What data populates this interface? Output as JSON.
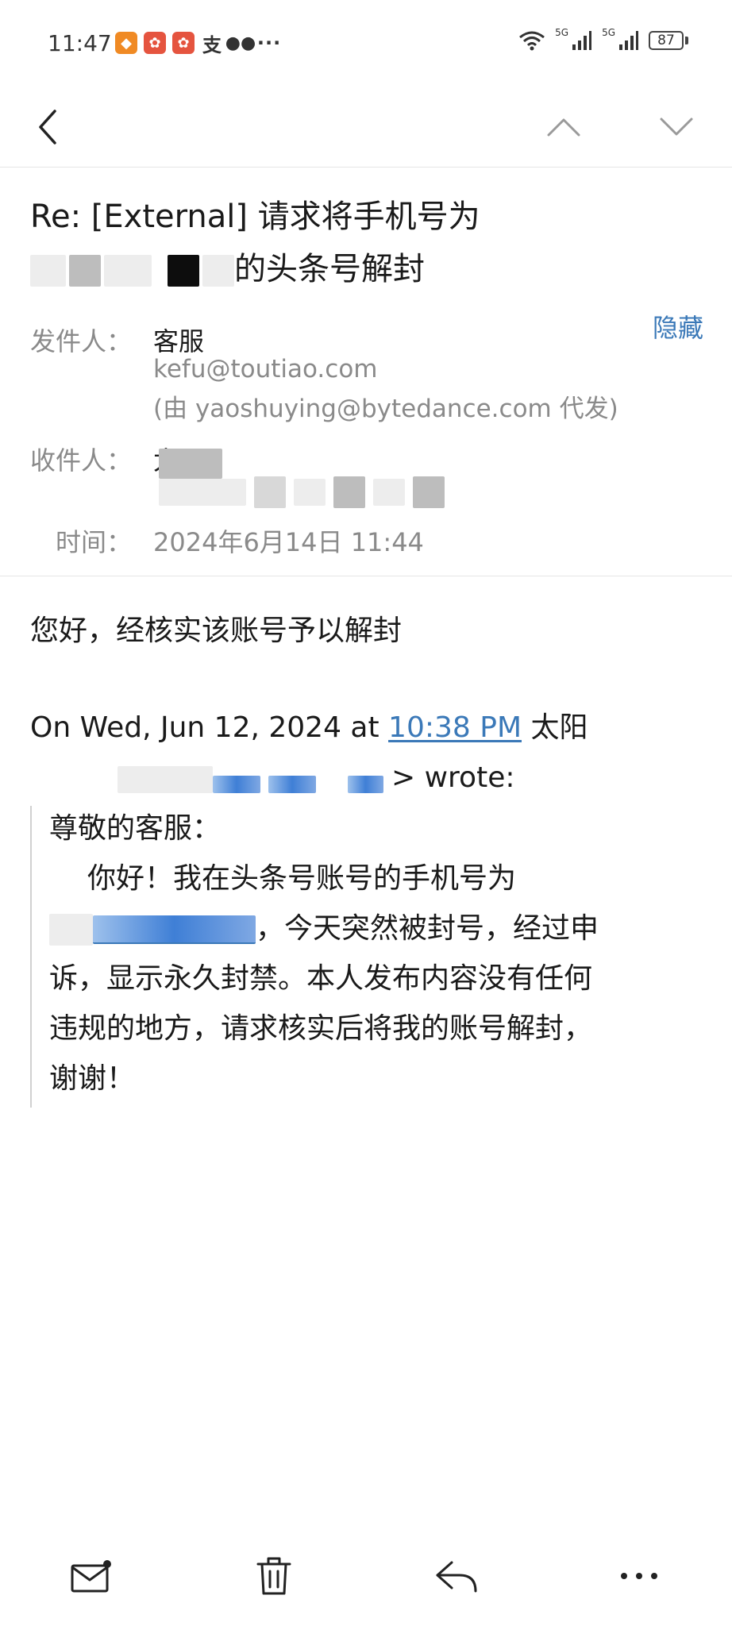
{
  "status_bar": {
    "time": "11:47",
    "network_1": "5G",
    "network_2": "5G",
    "battery": "87",
    "more": "···"
  },
  "email": {
    "subject_line1": "Re: [External] 请求将手机号为",
    "subject_line2_suffix": "的头条号解封",
    "sender_label": "发件人：",
    "sender_name": "客服",
    "sender_email": "kefu@toutiao.com",
    "sender_via": "(由 yaoshuying@bytedance.com 代发)",
    "hide_label": "隐藏",
    "recipient_label": "收件人：",
    "recipient_name": "太阳",
    "time_label": "时间：",
    "time_value": "2024年6月14日 11:44"
  },
  "body": {
    "reply": "您好，经核实该账号予以解封",
    "quote_intro_prefix": "On Wed, Jun 12, 2024 at ",
    "quote_intro_time": "10:38 PM",
    "quote_intro_name": " 太阳",
    "quote_intro_wrote": "> wrote:",
    "quote_greeting": "尊敬的客服：",
    "quote_line1": "你好！我在头条号账号的手机号为",
    "quote_line2_suffix": "，今天突然被封号，经过申",
    "quote_line3": "诉，显示永久封禁。本人发布内容没有任何",
    "quote_line4": "违规的地方，请求核实后将我的账号解封，",
    "quote_line5": "谢谢！"
  },
  "icons": {
    "back": "chevron-left-icon",
    "prev": "chevron-up-icon",
    "next": "chevron-down-icon",
    "compose": "mail-icon",
    "delete": "trash-icon",
    "reply": "reply-icon",
    "more": "more-icon"
  },
  "colors": {
    "link": "#3b79b8",
    "label": "#8a8a8a",
    "text": "#1a1a1a"
  }
}
